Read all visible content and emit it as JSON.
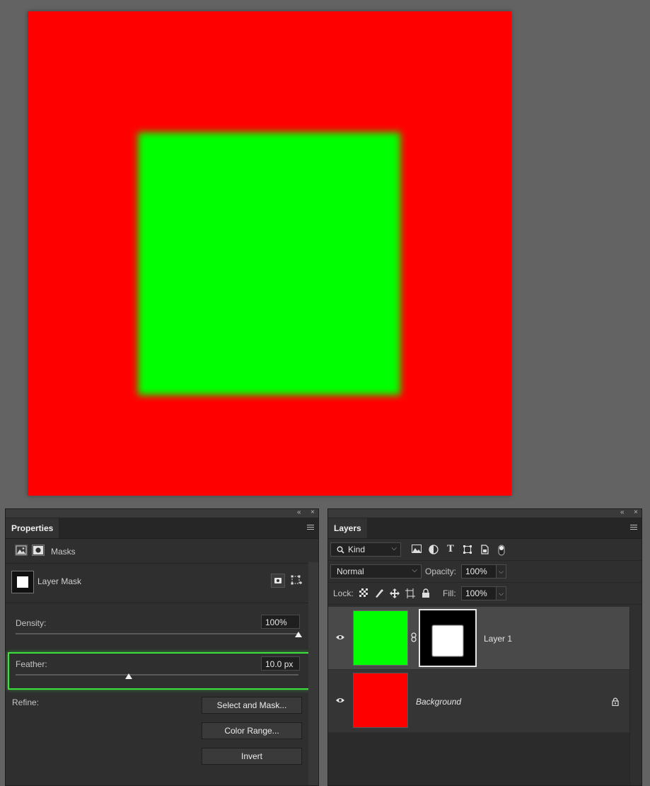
{
  "properties": {
    "tab_label": "Properties",
    "section_label": "Masks",
    "mask_type": "Layer Mask",
    "density": {
      "label": "Density:",
      "value": "100%",
      "fraction": 1.0
    },
    "feather": {
      "label": "Feather:",
      "value": "10.0 px",
      "fraction": 0.4
    },
    "refine_label": "Refine:",
    "buttons": {
      "select_and_mask": "Select and Mask...",
      "color_range": "Color Range...",
      "invert": "Invert"
    },
    "panel_controls": {
      "collapse": "«",
      "close": "×"
    }
  },
  "layers": {
    "tab_label": "Layers",
    "filter_kind": "Kind",
    "blend_mode": "Normal",
    "opacity_label": "Opacity:",
    "opacity_value": "100%",
    "lock_label": "Lock:",
    "fill_label": "Fill:",
    "fill_value": "100%",
    "panel_controls": {
      "collapse": "«",
      "close": "×"
    },
    "items": [
      {
        "name": "Layer 1",
        "selected": true,
        "thumb_color": "#00ff00",
        "has_mask": true
      },
      {
        "name": "Background",
        "selected": false,
        "thumb_color": "#ff0000",
        "locked": true
      }
    ]
  },
  "canvas": {
    "background_color": "#ff0000",
    "square_color": "#00ff00"
  },
  "colors": {
    "highlight": "#3ce03c",
    "panel_bg": "#2f2f2f",
    "workspace_bg": "#636363"
  }
}
